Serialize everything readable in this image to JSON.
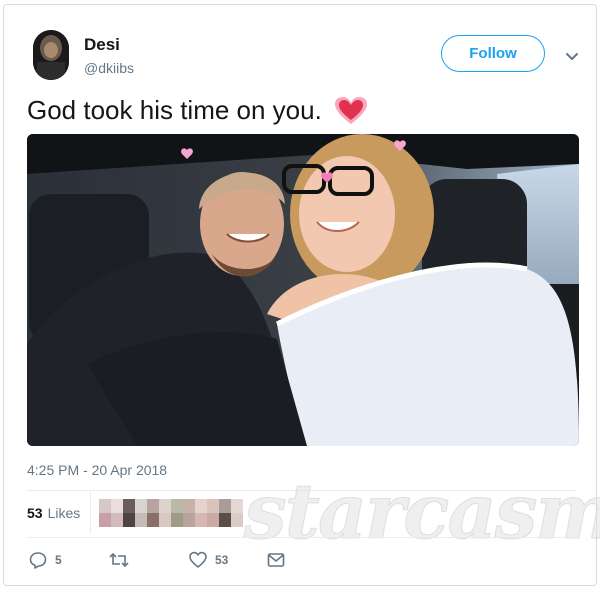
{
  "user": {
    "name": "Desi",
    "handle": "@dkiibs"
  },
  "follow_label": "Follow",
  "tweet": {
    "text": "God took his time on you."
  },
  "timestamp": "4:25 PM - 20 Apr 2018",
  "likes": {
    "count": "53",
    "label": "Likes"
  },
  "actions": {
    "replies": "5",
    "likes": "53"
  },
  "watermark": "starcasm",
  "colors": {
    "accent": "#1da1f2",
    "secondary_text": "#657786",
    "border": "#e6ecf0"
  },
  "icons": [
    "chevron-down-icon",
    "heart-emoji-icon",
    "reply-icon",
    "retweet-icon",
    "like-icon",
    "message-icon"
  ]
}
